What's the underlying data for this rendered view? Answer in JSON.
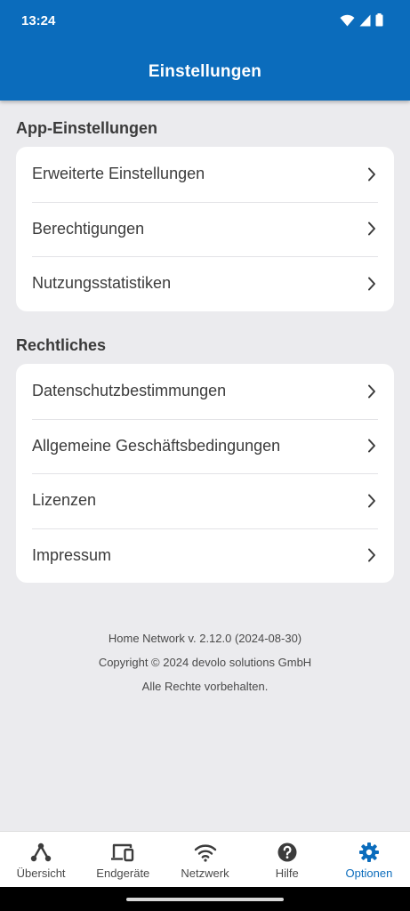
{
  "status_bar": {
    "time": "13:24"
  },
  "header": {
    "title": "Einstellungen"
  },
  "sections": [
    {
      "title": "App-Einstellungen",
      "items": [
        {
          "label": "Erweiterte Einstellungen"
        },
        {
          "label": "Berechtigungen"
        },
        {
          "label": "Nutzungsstatistiken"
        }
      ]
    },
    {
      "title": "Rechtliches",
      "items": [
        {
          "label": "Datenschutzbestimmungen"
        },
        {
          "label": "Allgemeine Geschäftsbedingungen"
        },
        {
          "label": "Lizenzen"
        },
        {
          "label": "Impressum"
        }
      ]
    }
  ],
  "footer": {
    "version": "Home Network v. 2.12.0 (2024-08-30)",
    "copyright": "Copyright © 2024 devolo solutions GmbH",
    "rights": "Alle Rechte vorbehalten."
  },
  "bottom_nav": {
    "active": "Optionen",
    "items": [
      {
        "label": "Übersicht",
        "icon": "network-graph-icon"
      },
      {
        "label": "Endgeräte",
        "icon": "devices-icon"
      },
      {
        "label": "Netzwerk",
        "icon": "wifi-icon"
      },
      {
        "label": "Hilfe",
        "icon": "help-icon"
      },
      {
        "label": "Optionen",
        "icon": "gear-icon"
      }
    ]
  },
  "colors": {
    "brand": "#0b6cbc",
    "background": "#ebebee",
    "card": "#ffffff",
    "text": "#3c3c3c"
  }
}
